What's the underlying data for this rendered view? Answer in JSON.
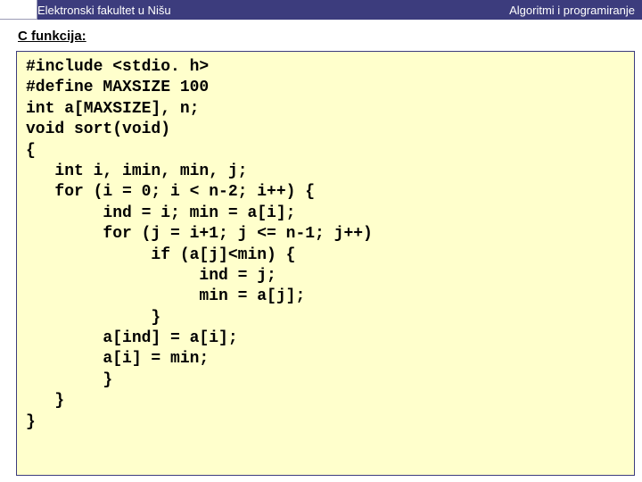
{
  "header": {
    "left_title": "Elektronski fakultet u Nišu",
    "right_title": "Algoritmi i programiranje"
  },
  "section": {
    "title": "C funkcija:"
  },
  "code": {
    "lines": [
      "#include <stdio. h>",
      "#define MAXSIZE 100",
      "int a[MAXSIZE], n;",
      "void sort(void)",
      "{",
      "   int i, imin, min, j;",
      "   for (i = 0; i < n-2; i++) {",
      "        ind = i; min = a[i];",
      "        for (j = i+1; j <= n-1; j++)",
      "             if (a[j]<min) {",
      "                  ind = j;",
      "                  min = a[j];",
      "             }",
      "        a[ind] = a[i];",
      "        a[i] = min;",
      "        }",
      "   }",
      "}"
    ]
  }
}
